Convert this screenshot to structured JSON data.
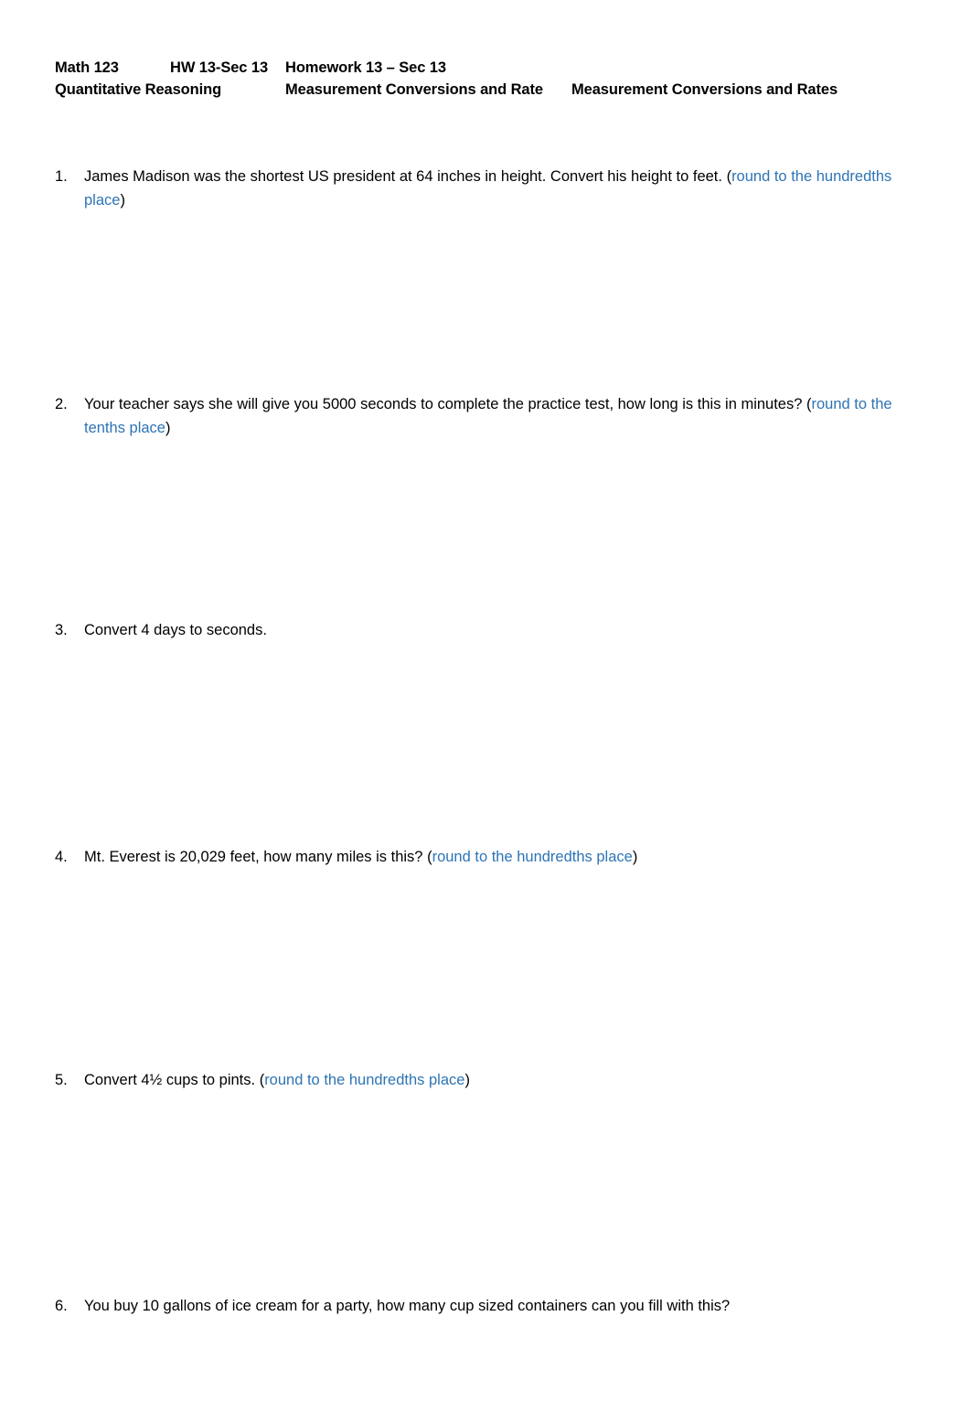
{
  "document": {
    "header": {
      "line1": {
        "course": "Math 123",
        "assignment_code": "HW 13-Sec 13",
        "assignment_title": "Homework 13 – Sec 13"
      },
      "line2": {
        "course_name": "Quantitative Reasoning",
        "topic": "Measurement Conversions and Rate",
        "topic_full": "Measurement Conversions and Rates"
      }
    },
    "hint_color": "#2E74B5",
    "text_color": "#000000",
    "page_background": "#FFFFFF",
    "questions": [
      {
        "number": "1.",
        "text": "James Madison was the shortest US president at 64 inches in height.  Convert his height to feet. ",
        "hint_open": "(",
        "hint": "round to the hundredths place",
        "hint_close": ")"
      },
      {
        "number": "2.",
        "text": "Your teacher says she will give you 5000 seconds to complete the practice test, how long is this in minutes? ",
        "hint_open": "(",
        "hint": "round to the tenths place",
        "hint_close": ")"
      },
      {
        "number": "3.",
        "text": "Convert 4 days to seconds.",
        "hint_open": "",
        "hint": "",
        "hint_close": ""
      },
      {
        "number": "4.",
        "text": "Mt. Everest is 20,029 feet, how many miles is this? ",
        "hint_open": "(",
        "hint": "round to the hundredths place",
        "hint_close": ")"
      },
      {
        "number": "5.",
        "text": "Convert 4½ cups to pints. ",
        "hint_open": "(",
        "hint": "round to the hundredths place",
        "hint_close": ")"
      },
      {
        "number": "6.",
        "text": "You buy 10 gallons of ice cream for a party, how many cup sized containers can you fill with this?",
        "hint_open": "",
        "hint": "",
        "hint_close": ""
      }
    ]
  }
}
